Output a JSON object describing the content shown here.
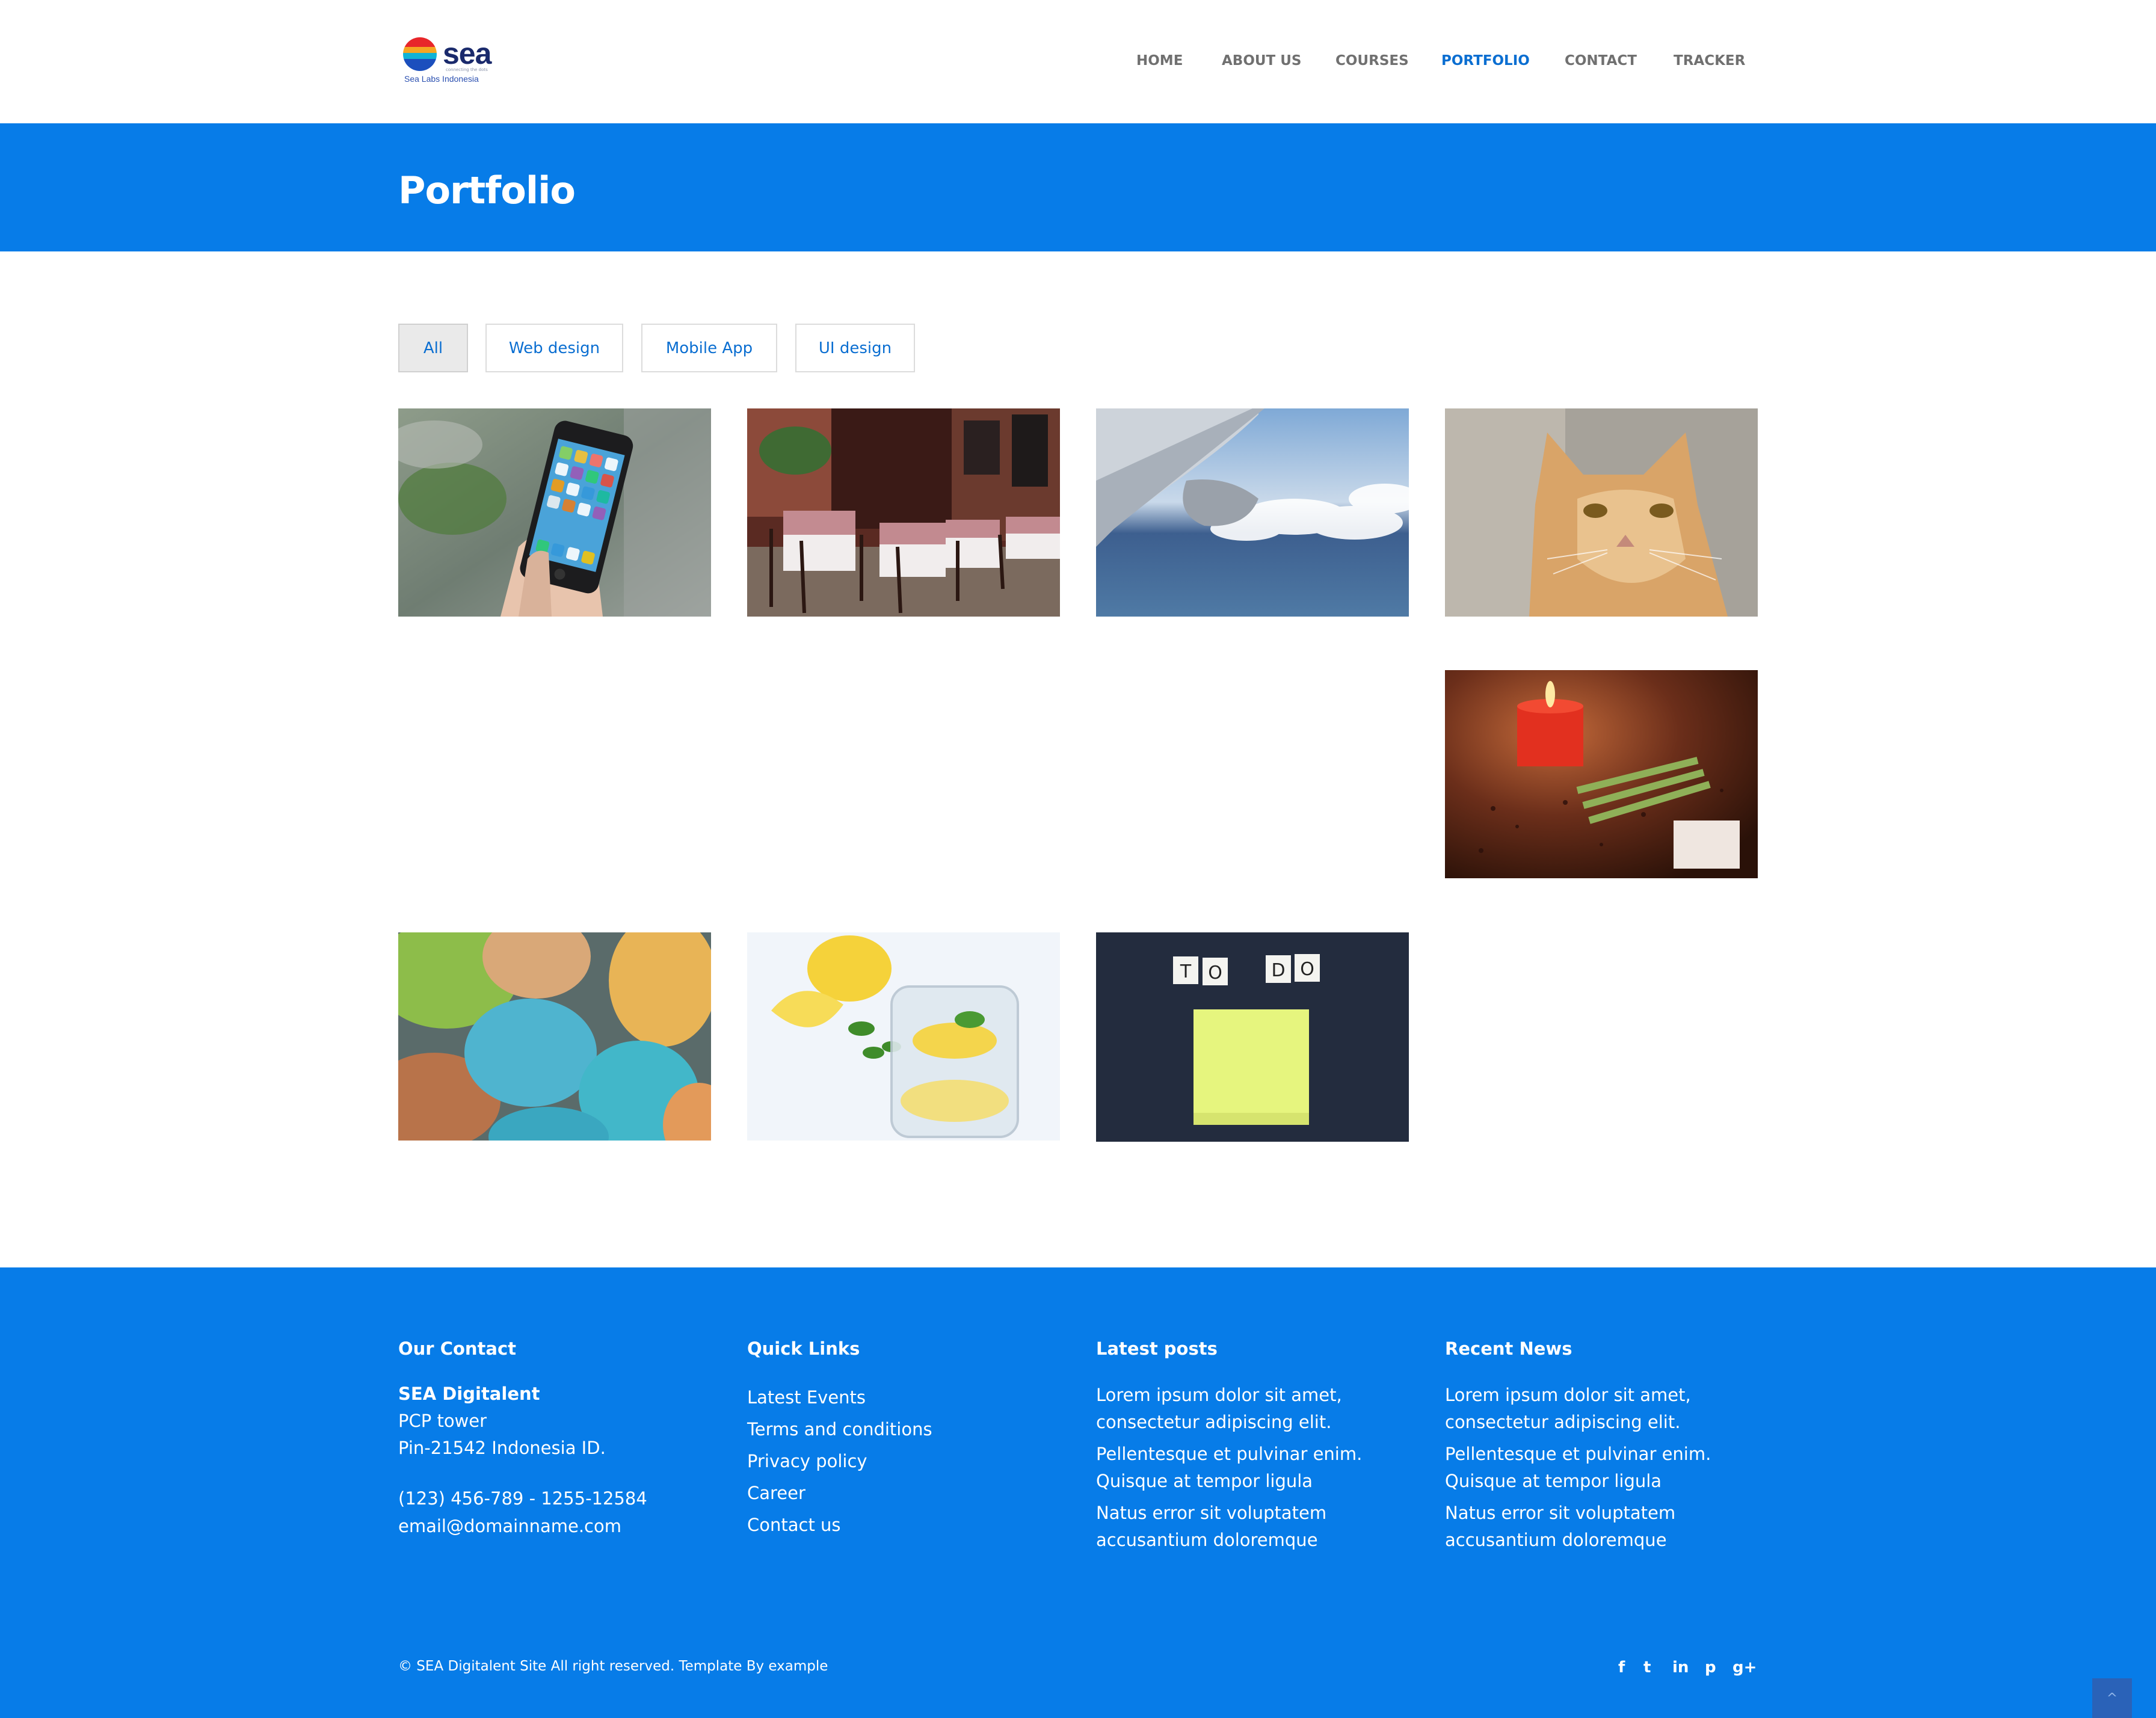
{
  "brand": {
    "name": "sea",
    "tagline": "connecting the dots",
    "subtitle": "Sea Labs Indonesia"
  },
  "nav": {
    "items": [
      {
        "label": "HOME"
      },
      {
        "label": "ABOUT US"
      },
      {
        "label": "COURSES"
      },
      {
        "label": "PORTFOLIO",
        "active": true
      },
      {
        "label": "CONTACT"
      },
      {
        "label": "TRACKER"
      }
    ]
  },
  "banner": {
    "title": "Portfolio"
  },
  "filters": [
    {
      "label": "All",
      "active": true
    },
    {
      "label": "Web design"
    },
    {
      "label": "Mobile App"
    },
    {
      "label": "UI design"
    }
  ],
  "gallery": [
    {
      "subject": "hand holding smartphone"
    },
    {
      "subject": "outdoor restaurant tables"
    },
    {
      "subject": "airplane wing above clouds"
    },
    {
      "subject": "orange cat"
    },
    {
      "subject": "red candle with flowers"
    },
    {
      "subject": "colored eggs"
    },
    {
      "subject": "lemon water glass"
    },
    {
      "subject": "TO DO sticky note"
    }
  ],
  "todo_letters": [
    "T",
    "O",
    "D",
    "O"
  ],
  "footer": {
    "contact": {
      "heading": "Our Contact",
      "company": "SEA Digitalent",
      "address1": "PCP tower",
      "address2": "Pin-21542 Indonesia ID.",
      "phone": "(123) 456-789 - 1255-12584",
      "email": "email@domainname.com"
    },
    "quick_links": {
      "heading": "Quick Links",
      "items": [
        "Latest Events",
        "Terms and conditions",
        "Privacy policy",
        "Career",
        "Contact us"
      ]
    },
    "latest_posts": {
      "heading": "Latest posts",
      "items": [
        "Lorem ipsum dolor sit amet, consectetur adipiscing elit.",
        "Pellentesque et pulvinar enim. Quisque at tempor ligula",
        "Natus error sit voluptatem accusantium doloremque"
      ]
    },
    "recent_news": {
      "heading": "Recent News",
      "items": [
        "Lorem ipsum dolor sit amet, consectetur adipiscing elit.",
        "Pellentesque et pulvinar enim. Quisque at tempor ligula",
        "Natus error sit voluptatem accusantium doloremque"
      ]
    },
    "copyright": "© SEA Digitalent Site All right reserved. Template By example",
    "social": [
      "facebook-icon",
      "twitter-icon",
      "linkedin-icon",
      "pinterest-icon",
      "google-plus-icon"
    ],
    "social_glyphs": [
      "f",
      "t",
      "in",
      "p",
      "g+"
    ]
  },
  "colors": {
    "primary": "#077ce8",
    "nav_active": "#0a6ed1",
    "nav_text": "#707070"
  },
  "back_to_top": "^"
}
